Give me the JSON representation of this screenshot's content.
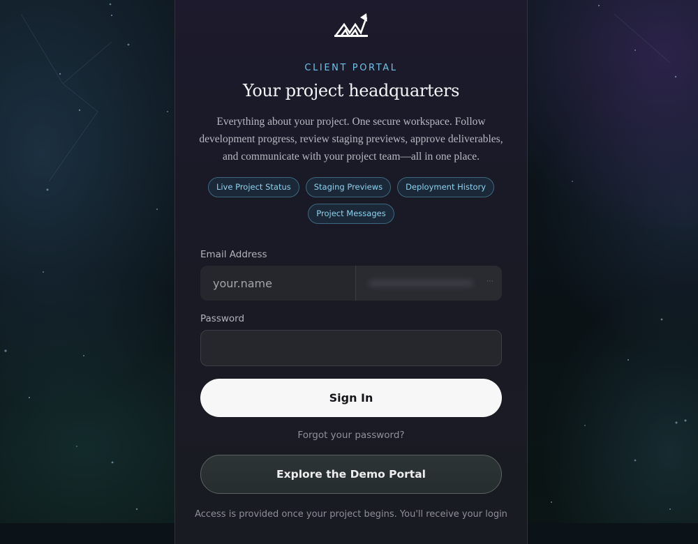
{
  "header": {
    "logo_icon": "rising-chart-logo-icon",
    "eyebrow": "CLIENT PORTAL",
    "title": "Your project headquarters",
    "description": "Everything about your project. One secure workspace. Follow development progress, review staging previews, approve deliverables, and communicate with your project team—all in one place."
  },
  "features": [
    {
      "label": "Live Project Status"
    },
    {
      "label": "Staging Previews"
    },
    {
      "label": "Deployment History"
    },
    {
      "label": "Project Messages"
    }
  ],
  "form": {
    "email_label": "Email Address",
    "email_placeholder": "your.name",
    "password_label": "Password",
    "signin_label": "Sign In",
    "forgot_label": "Forgot your password?",
    "demo_label": "Explore the Demo Portal"
  },
  "footer": {
    "access_note": "Access is provided once your project begins. You'll receive your login"
  },
  "colors": {
    "accent": "#6fc3e8",
    "card_bg": "#1c1a2c",
    "button_bg": "#f7f7f7"
  }
}
